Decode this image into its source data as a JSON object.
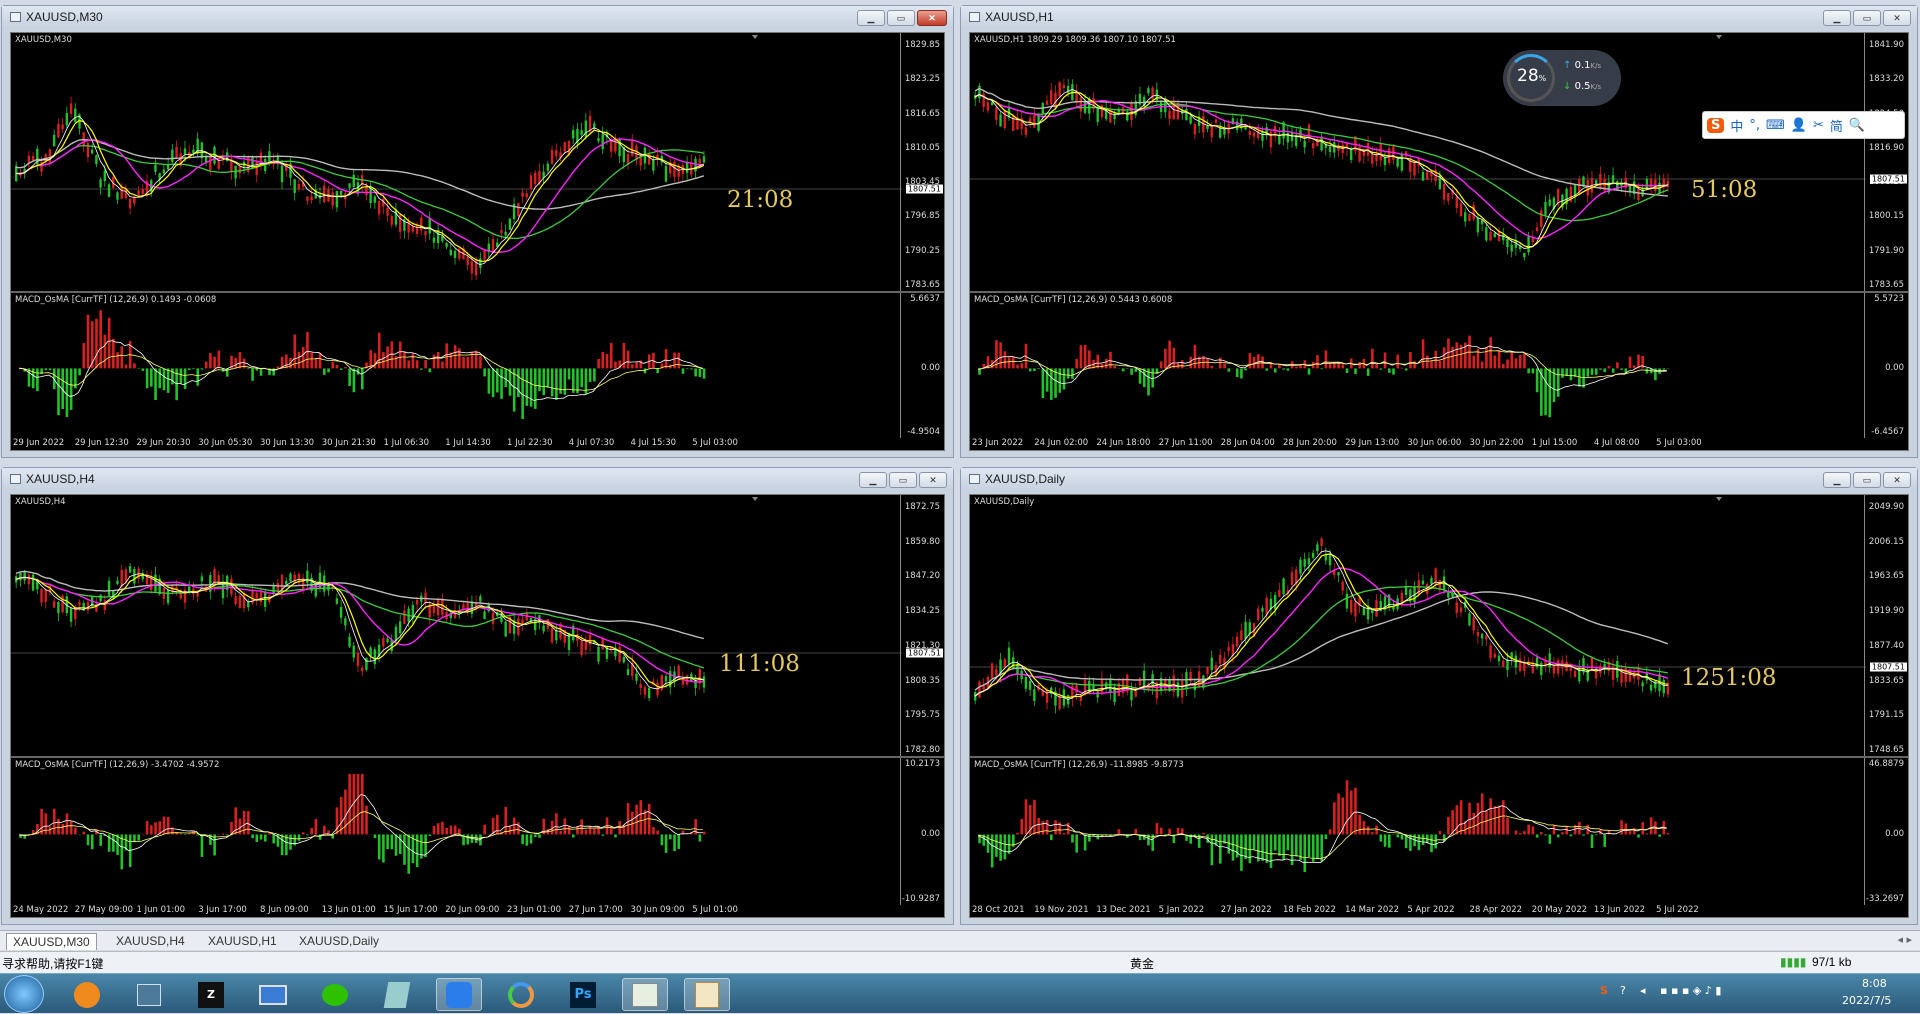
{
  "windows": [
    {
      "id": "w0",
      "title": "XAUUSD,M30",
      "chart_label": "XAUUSD,M30",
      "ind_label": "MACD_OsMA [CurrTF] (12,26,9) 0.1493 -0.0608",
      "timer": "21:08",
      "price_ticks": [
        "1829.85",
        "1823.25",
        "1816.65",
        "1810.05",
        "1803.45",
        "1796.85",
        "1790.25",
        "1783.65"
      ],
      "price_tag": "1807.51",
      "ind_ticks": [
        "5.6637",
        "0.00",
        "-4.9504"
      ],
      "x_ticks": [
        "29 Jun 2022",
        "29 Jun 12:30",
        "29 Jun 20:30",
        "30 Jun 05:30",
        "30 Jun 13:30",
        "30 Jun 21:30",
        "1 Jul 06:30",
        "1 Jul 14:30",
        "1 Jul 22:30",
        "4 Jul 07:30",
        "4 Jul 15:30",
        "5 Jul 03:00"
      ],
      "shape": [
        0.55,
        0.5,
        0.25,
        0.6,
        0.7,
        0.55,
        0.45,
        0.5,
        0.55,
        0.5,
        0.65,
        0.7,
        0.6,
        0.75,
        0.8,
        0.9,
        1.0,
        0.85,
        0.6,
        0.45,
        0.35,
        0.45,
        0.5,
        0.55,
        0.5
      ]
    },
    {
      "id": "w1",
      "title": "XAUUSD,H1",
      "chart_label": "XAUUSD,H1  1809.29 1809.36 1807.10 1807.51",
      "ind_label": "MACD_OsMA [CurrTF] (12,26,9) 0.5443 0.6008",
      "timer": "51:08",
      "price_ticks": [
        "1841.90",
        "1833.20",
        "1824.50",
        "1816.90",
        "1808.20",
        "1800.15",
        "1791.90",
        "1783.65"
      ],
      "price_tag": "1807.51",
      "ind_ticks": [
        "5.5723",
        "0.00",
        "-6.4567"
      ],
      "x_ticks": [
        "23 Jun 2022",
        "24 Jun 02:00",
        "24 Jun 18:00",
        "27 Jun 11:00",
        "28 Jun 04:00",
        "28 Jun 20:00",
        "29 Jun 13:00",
        "30 Jun 06:00",
        "30 Jun 22:00",
        "1 Jul 15:00",
        "4 Jul 08:00",
        "5 Jul 03:00"
      ],
      "shape": [
        0.2,
        0.3,
        0.35,
        0.15,
        0.25,
        0.3,
        0.2,
        0.3,
        0.35,
        0.35,
        0.4,
        0.38,
        0.42,
        0.45,
        0.48,
        0.5,
        0.6,
        0.75,
        0.85,
        0.95,
        0.7,
        0.6,
        0.62,
        0.64,
        0.63
      ]
    },
    {
      "id": "w2",
      "title": "XAUUSD,H4",
      "chart_label": "XAUUSD,H4",
      "ind_label": "MACD_OsMA [CurrTF] (12,26,9) -3.4702 -4.9572",
      "timer": "111:08",
      "price_ticks": [
        "1872.75",
        "1859.80",
        "1847.20",
        "1834.25",
        "1821.30",
        "1808.35",
        "1795.75",
        "1782.80"
      ],
      "price_tag": "1807.51",
      "ind_ticks": [
        "10.2173",
        "0.00",
        "-10.9287"
      ],
      "x_ticks": [
        "24 May 2022",
        "27 May 09:00",
        "1 Jun 01:00",
        "3 Jun 17:00",
        "8 Jun 09:00",
        "13 Jun 01:00",
        "15 Jun 17:00",
        "20 Jun 09:00",
        "23 Jun 01:00",
        "27 Jun 17:00",
        "30 Jun 09:00",
        "5 Jul 01:00"
      ],
      "shape": [
        0.3,
        0.35,
        0.45,
        0.4,
        0.25,
        0.35,
        0.35,
        0.3,
        0.4,
        0.35,
        0.3,
        0.35,
        0.7,
        0.6,
        0.4,
        0.45,
        0.4,
        0.5,
        0.5,
        0.55,
        0.6,
        0.65,
        0.8,
        0.75,
        0.75
      ]
    },
    {
      "id": "w3",
      "title": "XAUUSD,Daily",
      "chart_label": "XAUUSD,Daily",
      "ind_label": "MACD_OsMA [CurrTF] (12,26,9) -11.8985 -9.8773",
      "timer": "1251:08",
      "price_ticks": [
        "2049.90",
        "2006.15",
        "1963.65",
        "1919.90",
        "1877.40",
        "1833.65",
        "1791.15",
        "1748.65"
      ],
      "price_tag": "1807.51",
      "ind_ticks": [
        "46.8879",
        "0.00",
        "-33.2697"
      ],
      "x_ticks": [
        "28 Oct 2021",
        "19 Nov 2021",
        "13 Dec 2021",
        "5 Jan 2022",
        "27 Jan 2022",
        "18 Feb 2022",
        "14 Mar 2022",
        "5 Apr 2022",
        "28 Apr 2022",
        "20 May 2022",
        "13 Jun 2022",
        "5 Jul 2022"
      ],
      "shape": [
        0.85,
        0.65,
        0.8,
        0.85,
        0.8,
        0.82,
        0.78,
        0.8,
        0.75,
        0.6,
        0.45,
        0.3,
        0.15,
        0.4,
        0.45,
        0.35,
        0.3,
        0.45,
        0.65,
        0.7,
        0.7,
        0.72,
        0.72,
        0.75,
        0.8
      ]
    }
  ],
  "tabs": [
    "XAUUSD,M30",
    "XAUUSD,H4",
    "XAUUSD,H1",
    "XAUUSD,Daily"
  ],
  "status": {
    "help": "寻求帮助,请按F1键",
    "symbol": "黄金",
    "traffic": "97/1 kb"
  },
  "speed": {
    "percent": "28",
    "unit": "%",
    "up": "0.1",
    "down": "0.5",
    "rate_unit": "K/s"
  },
  "ime": {
    "items": [
      "中",
      "°,",
      "⌨",
      "👤",
      "✂",
      "简",
      "🔍"
    ]
  },
  "clock": {
    "time": "8:08",
    "date": "2022/7/5"
  },
  "colors": {
    "bull": "#22c22b",
    "bear": "#d92020",
    "ma_fast": "#ffff00",
    "ma_mid": "#ff22ff",
    "ma_slow": "#3ccc3c",
    "ma_long": "#bcbcbc"
  }
}
